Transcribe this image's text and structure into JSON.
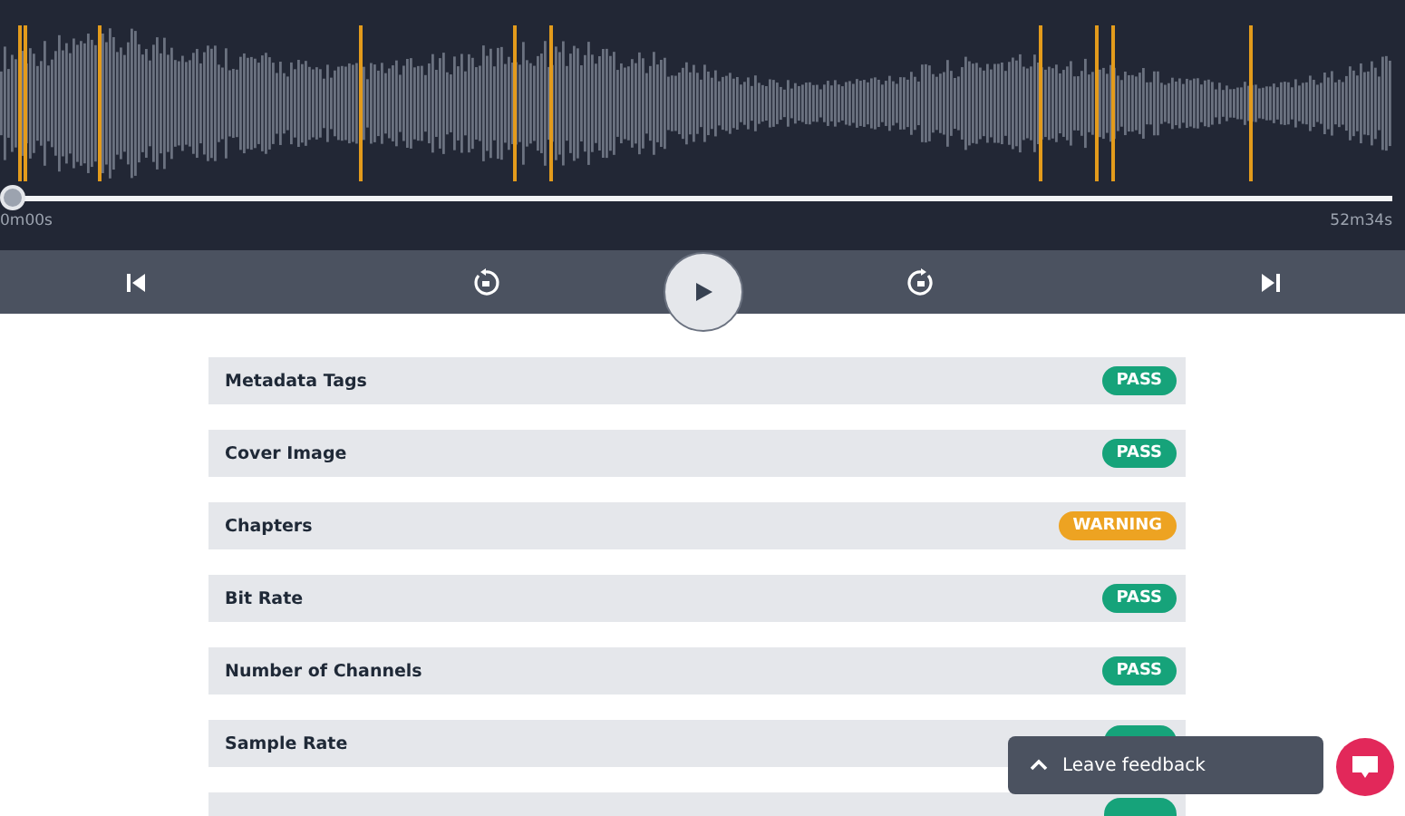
{
  "player": {
    "progress": {
      "level": 0
    },
    "elapsed": "0m00s",
    "duration": "52m34s"
  },
  "checks": [
    {
      "label": "Metadata Tags",
      "status": "PASS",
      "kind": "pass"
    },
    {
      "label": "Cover Image",
      "status": "PASS",
      "kind": "pass"
    },
    {
      "label": "Chapters",
      "status": "WARNING",
      "kind": "warning"
    },
    {
      "label": "Bit Rate",
      "status": "PASS",
      "kind": "pass"
    },
    {
      "label": "Number of Channels",
      "status": "PASS",
      "kind": "pass"
    },
    {
      "label": "Sample Rate",
      "kind": "pass"
    },
    {
      "kind": "pass"
    }
  ],
  "feedback": {
    "label": "Leave feedback"
  }
}
